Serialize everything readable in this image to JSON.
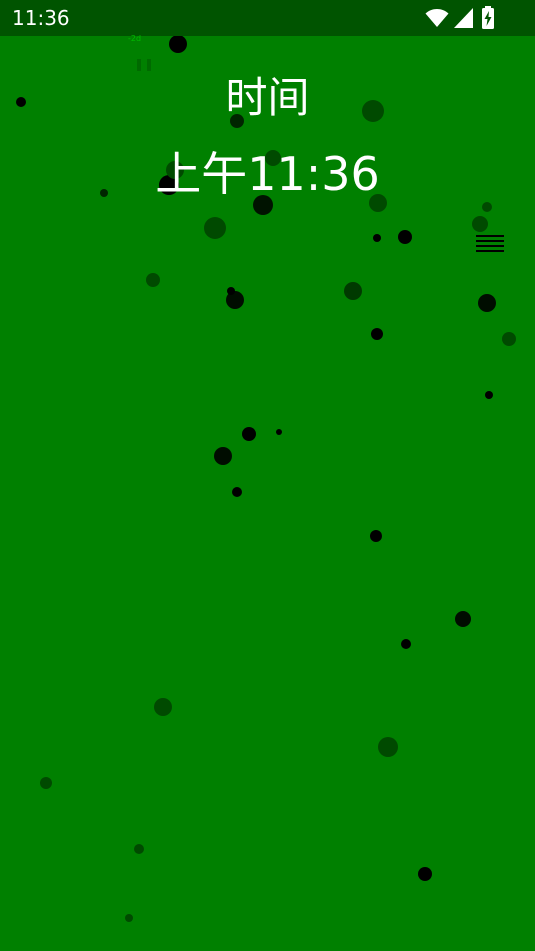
{
  "status_bar": {
    "time": "11:36",
    "icons": [
      "wifi-icon",
      "cell-signal-icon",
      "battery-charging-icon"
    ],
    "background": "#005400"
  },
  "screen": {
    "background": "#008000",
    "title": "时间",
    "time_value": "上午11:36",
    "menu_icon": "hamburger-icon",
    "overlay_label": "-2d"
  }
}
